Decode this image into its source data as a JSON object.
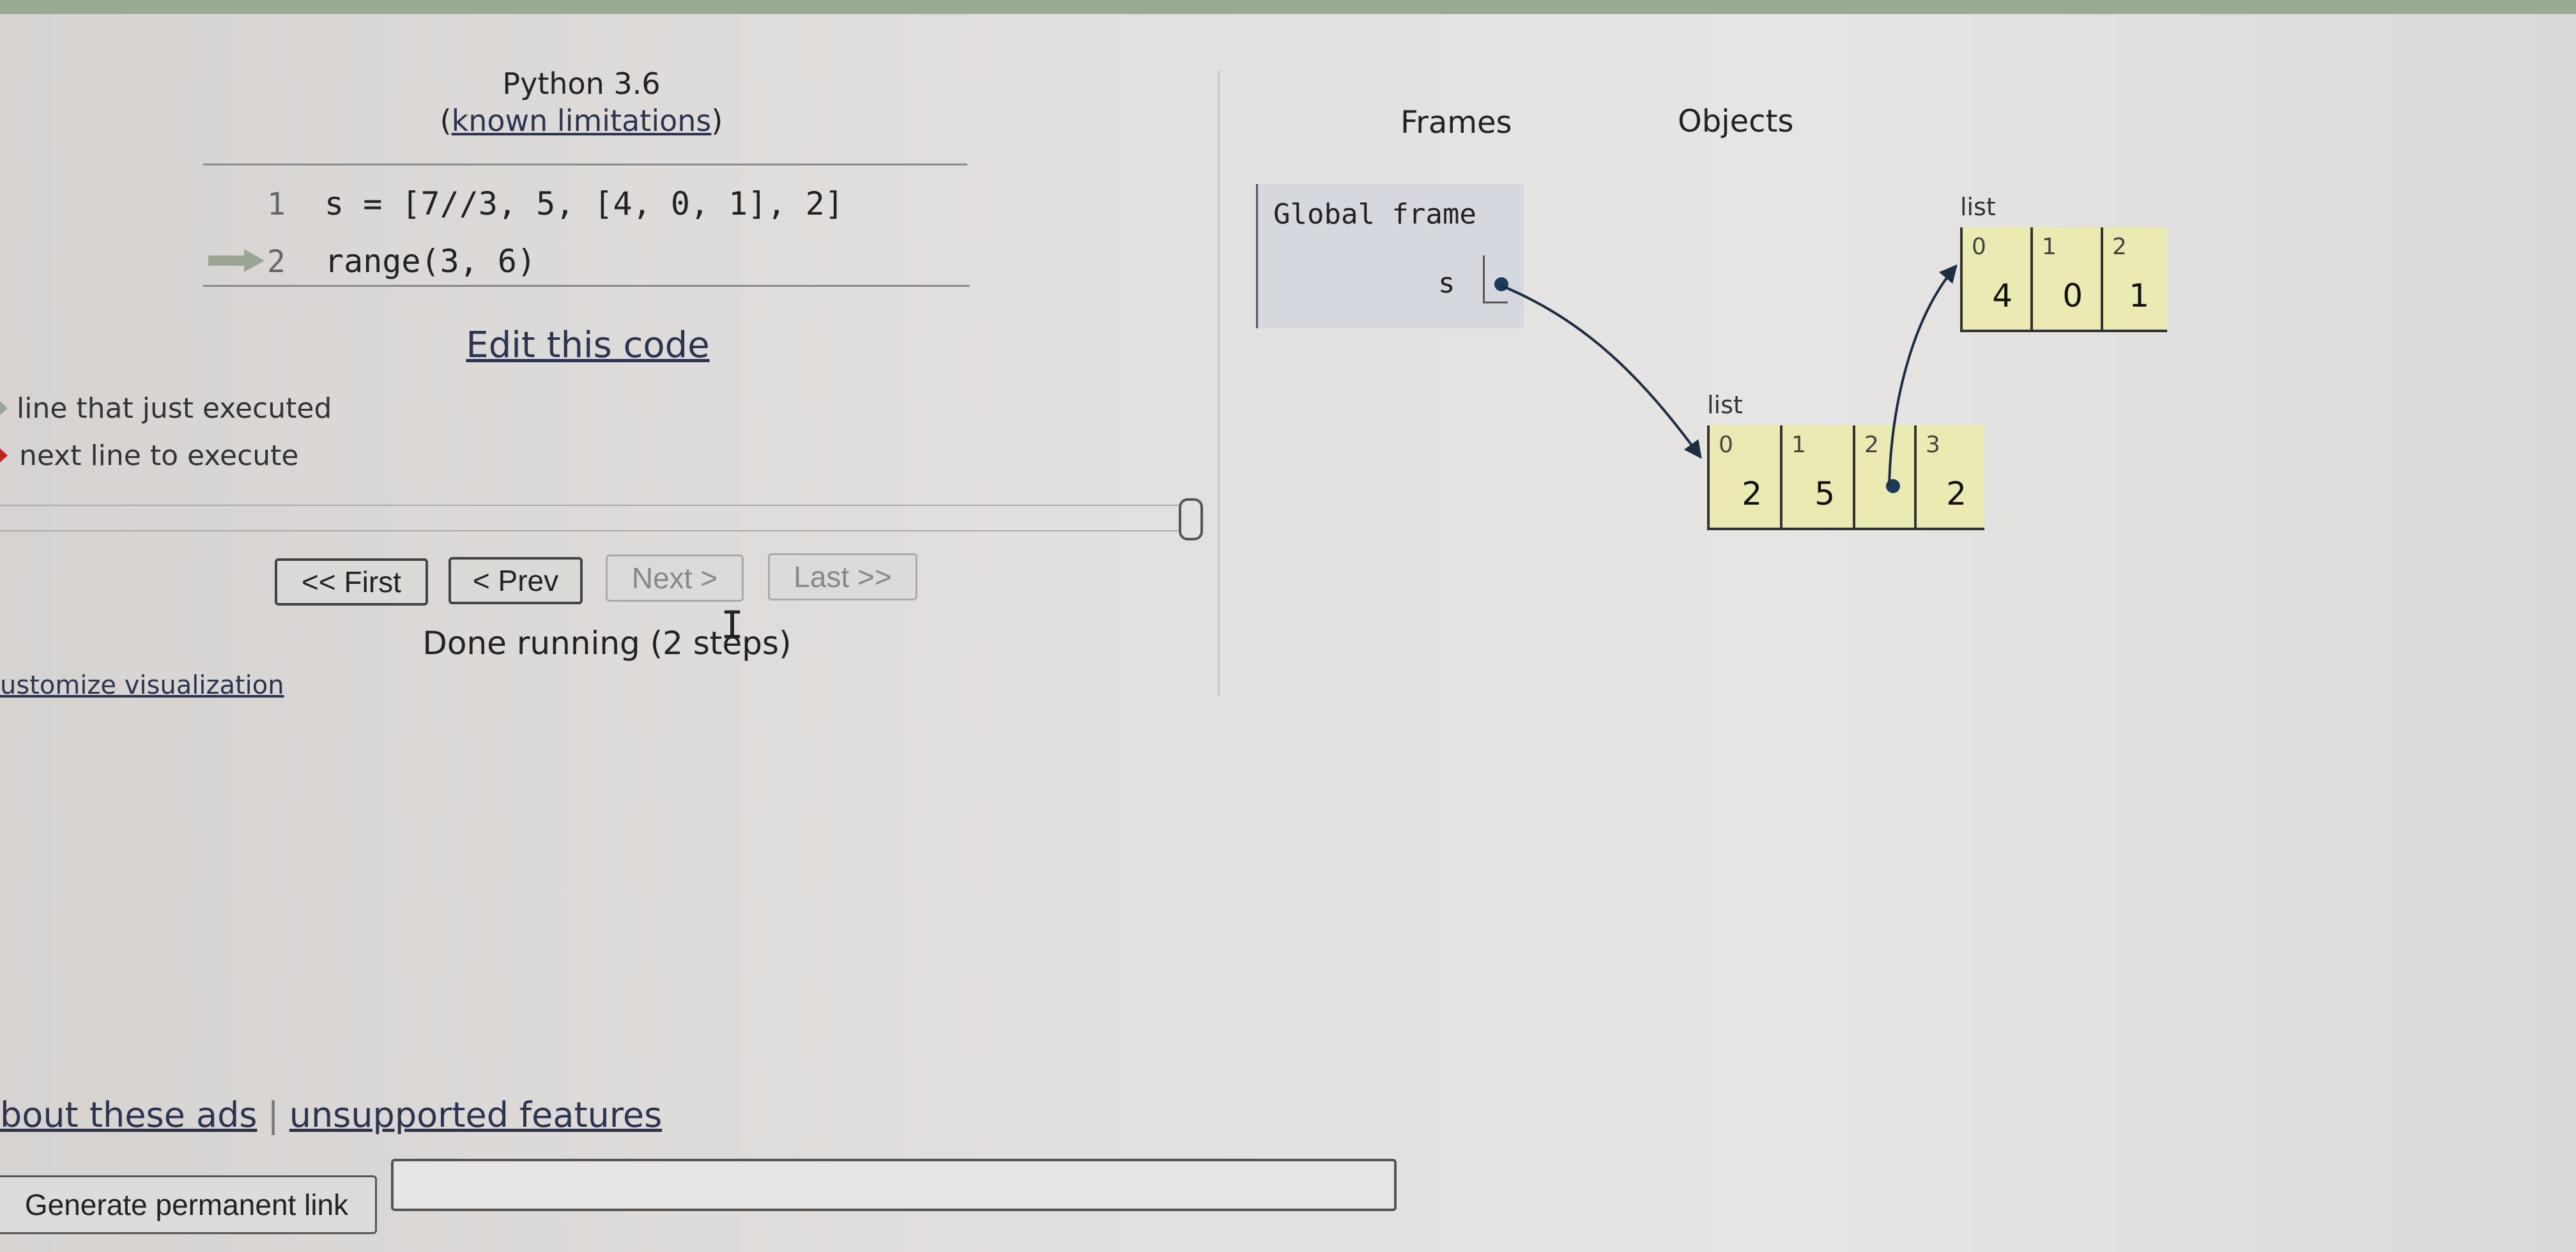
{
  "header": {
    "language": "Python 3.6",
    "limitations_open": "(",
    "limitations_link": "known limitations",
    "limitations_close": ")"
  },
  "code": {
    "lines": [
      {
        "number": "1",
        "text": "s = [7//3, 5, [4, 0, 1], 2]"
      },
      {
        "number": "2",
        "text": "range(3, 6)"
      }
    ],
    "current_line_arrow": "line-2"
  },
  "edit_link": "Edit this code",
  "legend": {
    "just_executed": "line that just executed",
    "next_to_execute": "next line to execute",
    "just_executed_color": "#9aa595",
    "next_color": "#c0281e"
  },
  "slider": {
    "step": 2,
    "total_steps": 2
  },
  "nav": {
    "first": "<< First",
    "prev": "< Prev",
    "next": "Next >",
    "last": "Last >>"
  },
  "status": "Done running (2 steps)",
  "customize_link": "ustomize visualization",
  "viz": {
    "frames_header": "Frames",
    "objects_header": "Objects",
    "global_frame": {
      "title": "Global frame",
      "variables": [
        {
          "name": "s",
          "value": "pointer"
        }
      ]
    },
    "objects": [
      {
        "type": "list",
        "label": "list",
        "items": [
          {
            "index": "0",
            "value": "2"
          },
          {
            "index": "1",
            "value": "5"
          },
          {
            "index": "2",
            "value": "pointer"
          },
          {
            "index": "3",
            "value": "2"
          }
        ]
      },
      {
        "type": "list",
        "label": "list",
        "items": [
          {
            "index": "0",
            "value": "4"
          },
          {
            "index": "1",
            "value": "0"
          },
          {
            "index": "2",
            "value": "1"
          }
        ]
      }
    ]
  },
  "footer": {
    "about_ads": "bout these ads",
    "separator": "|",
    "unsupported": "unsupported features",
    "permalink_button": "Generate permanent link",
    "permalink_value": ""
  },
  "colors": {
    "list_cell": "#eaeab2",
    "frame_bg": "#d5d9df",
    "pointer": "#1c3a5c"
  }
}
